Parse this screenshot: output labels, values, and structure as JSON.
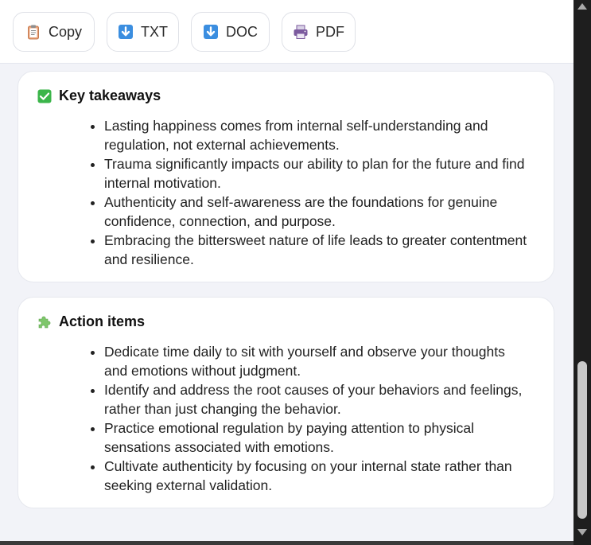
{
  "toolbar": {
    "copy_label": "Copy",
    "txt_label": "TXT",
    "doc_label": "DOC",
    "pdf_label": "PDF"
  },
  "icons": {
    "copy": "clipboard-icon",
    "txt": "download-arrow-icon",
    "doc": "download-arrow-icon",
    "pdf": "printer-icon",
    "takeaways": "check-mark-icon",
    "actions": "puzzle-piece-icon"
  },
  "colors": {
    "check_green": "#3bb54a",
    "download_blue": "#3b8ee0",
    "printer_purple": "#7b5a9e",
    "puzzle_green": "#7ec66b"
  },
  "takeaways": {
    "title": "Key takeaways",
    "items": [
      "Lasting happiness comes from internal self-understanding and regulation, not external achievements.",
      "Trauma significantly impacts our ability to plan for the future and find internal motivation.",
      "Authenticity and self-awareness are the foundations for genuine confidence, connection, and purpose.",
      "Embracing the bittersweet nature of life leads to greater contentment and resilience."
    ]
  },
  "actions": {
    "title": "Action items",
    "items": [
      "Dedicate time daily to sit with yourself and observe your thoughts and emotions without judgment.",
      "Identify and address the root causes of your behaviors and feelings, rather than just changing the behavior.",
      "Practice emotional regulation by paying attention to physical sensations associated with emotions.",
      "Cultivate authenticity by focusing on your internal state rather than seeking external validation."
    ]
  }
}
